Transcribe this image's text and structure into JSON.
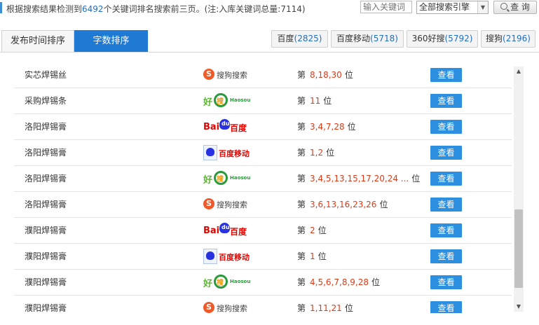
{
  "summary": {
    "prefix": "根据搜索结果检测到",
    "count": "6492",
    "suffix": "个关键词排名搜索前三页。(注:入库关键词总量:7114)"
  },
  "search": {
    "placeholder": "输入关键词"
  },
  "engine_select": {
    "selected": "全部搜索引擎"
  },
  "query_button": {
    "label": "查 询"
  },
  "sort_tabs": [
    {
      "label": "发布时间排序",
      "active": false
    },
    {
      "label": "字数排序",
      "active": true
    }
  ],
  "engine_tabs": [
    {
      "name": "百度",
      "count": "(2825)"
    },
    {
      "name": "百度移动",
      "count": "(5718)"
    },
    {
      "name": "360好搜",
      "count": "(5792)"
    },
    {
      "name": "搜狗",
      "count": "(2196)"
    }
  ],
  "logos": {
    "sogou": {
      "mark": "S",
      "text": "搜狗搜索"
    },
    "haosou": {
      "mark": "好",
      "ring": "搜",
      "text": "Haosou"
    },
    "baidu": {
      "mark": "Bai",
      "paw": "du",
      "text": "百度"
    },
    "baidu_mobile": {
      "text": "百度移动"
    }
  },
  "rows": [
    {
      "keyword": "实芯焊锡丝",
      "engine": "sogou",
      "rank_prefix": "第",
      "positions": "8,18,30",
      "rank_suffix": "位",
      "action": "查看"
    },
    {
      "keyword": "采购焊锡条",
      "engine": "haosou",
      "rank_prefix": "第",
      "positions": "11",
      "rank_suffix": "位",
      "action": "查看"
    },
    {
      "keyword": "洛阳焊锡膏",
      "engine": "baidu",
      "rank_prefix": "第",
      "positions": "3,4,7,28",
      "rank_suffix": "位",
      "action": "查看"
    },
    {
      "keyword": "洛阳焊锡膏",
      "engine": "baidu_mobile",
      "rank_prefix": "第",
      "positions": "1,2",
      "rank_suffix": "位",
      "action": "查看"
    },
    {
      "keyword": "洛阳焊锡膏",
      "engine": "haosou",
      "rank_prefix": "第",
      "positions": "3,4,5,13,15,17,20,24 ...",
      "rank_suffix": "位",
      "action": "查看"
    },
    {
      "keyword": "洛阳焊锡膏",
      "engine": "sogou",
      "rank_prefix": "第",
      "positions": "3,6,13,16,23,26",
      "rank_suffix": "位",
      "action": "查看"
    },
    {
      "keyword": "濮阳焊锡膏",
      "engine": "baidu",
      "rank_prefix": "第",
      "positions": "2",
      "rank_suffix": "位",
      "action": "查看"
    },
    {
      "keyword": "濮阳焊锡膏",
      "engine": "baidu_mobile",
      "rank_prefix": "第",
      "positions": "1",
      "rank_suffix": "位",
      "action": "查看"
    },
    {
      "keyword": "濮阳焊锡膏",
      "engine": "haosou",
      "rank_prefix": "第",
      "positions": "4,5,6,7,8,9,28",
      "rank_suffix": "位",
      "action": "查看"
    },
    {
      "keyword": "濮阳焊锡膏",
      "engine": "sogou",
      "rank_prefix": "第",
      "positions": "1,11,21",
      "rank_suffix": "位",
      "action": "查看"
    }
  ],
  "colors": {
    "accent": "#1f7ad3",
    "count_blue": "#1f6fc5",
    "rank_red": "#e03a16",
    "view_button": "#2d8fe0"
  }
}
